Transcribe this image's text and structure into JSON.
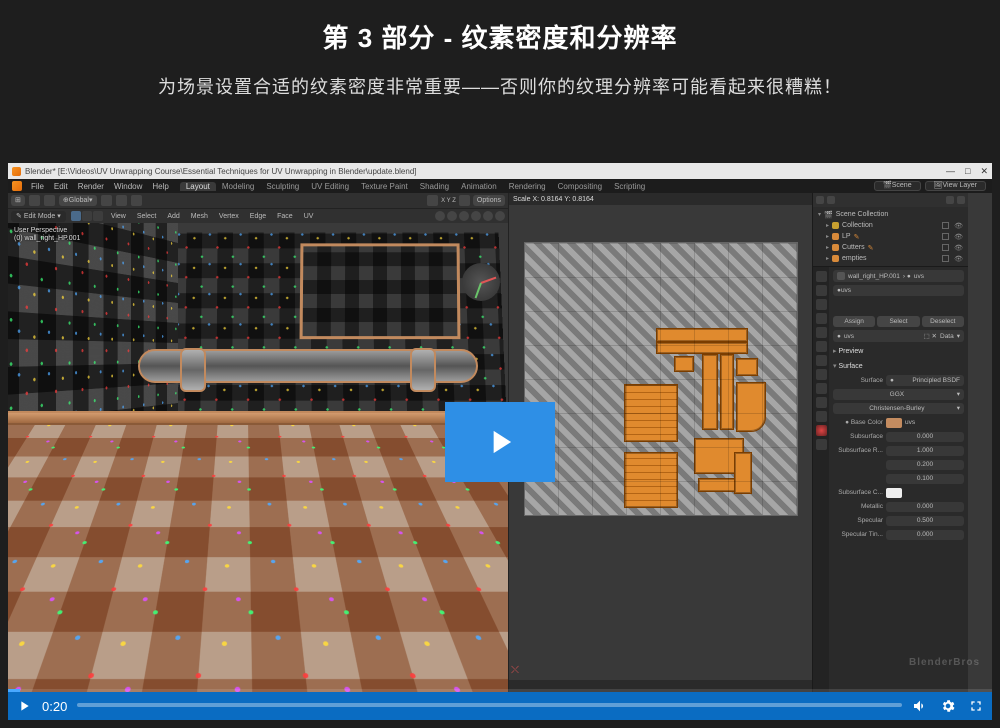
{
  "header": {
    "title": "第 3 部分 - 纹素密度和分辨率",
    "subtitle": "为场景设置合适的纹素密度非常重要——否则你的纹理分辨率可能看起来很糟糕！"
  },
  "titlebar": {
    "text": "Blender* [E:\\Videos\\UV Unwrapping Course\\Essential Techniques for UV Unwrapping in Blender\\update.blend]",
    "minimize": "—",
    "close": "✕"
  },
  "menubar": {
    "items": [
      "File",
      "Edit",
      "Render",
      "Window",
      "Help"
    ],
    "tabs": [
      "Layout",
      "Modeling",
      "Sculpting",
      "UV Editing",
      "Texture Paint",
      "Shading",
      "Animation",
      "Rendering",
      "Compositing",
      "Scripting"
    ],
    "active_tab": 0,
    "scene_label": "Scene",
    "viewlayer_label": "View Layer"
  },
  "vp3d": {
    "mode": "Edit Mode",
    "orient": "Global",
    "options": "Options",
    "sub_menus": [
      "View",
      "Select",
      "Add",
      "Mesh",
      "Vertex",
      "Edge",
      "Face",
      "UV"
    ],
    "info_line1": "User Perspective",
    "info_line2": "(0) wall_right_HP.001"
  },
  "uv": {
    "scale_text": "Scale X: 0.8164   Y: 0.8164"
  },
  "outliner": {
    "root": "Scene Collection",
    "items": [
      {
        "name": "Collection",
        "icon": "yellow"
      },
      {
        "name": "LP",
        "icon": "orange"
      },
      {
        "name": "Cutters",
        "icon": "orange"
      },
      {
        "name": "empties",
        "icon": "orange"
      }
    ]
  },
  "props": {
    "breadcrumb_obj": "wall_right_HP.001",
    "breadcrumb_mat": "uvs",
    "mat_slot": "uvs",
    "buttons": [
      "Assign",
      "Select",
      "Deselect"
    ],
    "mat_field_label": "uvs",
    "data_label": "Data",
    "preview": "Preview",
    "surface": "Surface",
    "surface_label": "Surface",
    "shader": "Principled BSDF",
    "dist": "GGX",
    "sss_method": "Christensen-Burley",
    "base_color_label": "Base Color",
    "base_color_value": "uvs",
    "rows": [
      {
        "k": "Subsurface",
        "v": "0.000"
      },
      {
        "k": "Subsurface R...",
        "v": "1.000"
      },
      {
        "k": "",
        "v": "0.200"
      },
      {
        "k": "",
        "v": "0.100"
      },
      {
        "k": "Subsurface C...",
        "v": ""
      },
      {
        "k": "Metallic",
        "v": "0.000"
      },
      {
        "k": "Specular",
        "v": "0.500"
      },
      {
        "k": "Specular Tin...",
        "v": "0.000"
      }
    ]
  },
  "video": {
    "time": "0:20",
    "watermark": "BlenderBros"
  }
}
